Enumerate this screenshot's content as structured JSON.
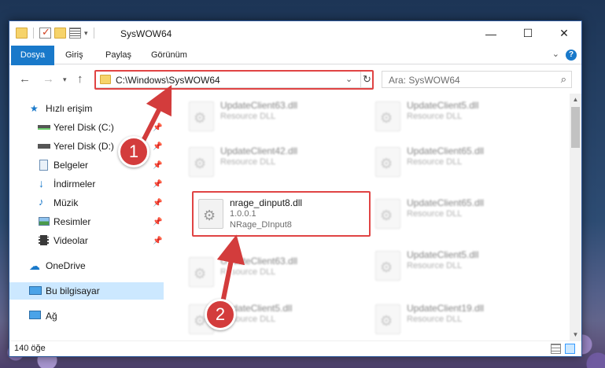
{
  "window": {
    "title": "SysWOW64"
  },
  "ribbon": {
    "tabs": [
      "Dosya",
      "Giriş",
      "Paylaş",
      "Görünüm"
    ]
  },
  "address": {
    "path": "C:\\Windows\\SysWOW64"
  },
  "search": {
    "placeholder": "Ara: SysWOW64"
  },
  "sidebar": {
    "items": [
      {
        "label": "Hızlı erişim",
        "icon": "star-icon"
      },
      {
        "label": "Yerel Disk (C:)",
        "icon": "drive-icon",
        "pinned": true
      },
      {
        "label": "Yerel Disk (D:)",
        "icon": "drive-icon",
        "pinned": true
      },
      {
        "label": "Belgeler",
        "icon": "documents-icon",
        "pinned": true
      },
      {
        "label": "İndirmeler",
        "icon": "download-icon",
        "pinned": true
      },
      {
        "label": "Müzik",
        "icon": "music-icon",
        "pinned": true
      },
      {
        "label": "Resimler",
        "icon": "pictures-icon",
        "pinned": true
      },
      {
        "label": "Videolar",
        "icon": "videos-icon",
        "pinned": true
      },
      {
        "label": "OneDrive",
        "icon": "cloud-icon"
      },
      {
        "label": "Bu bilgisayar",
        "icon": "computer-icon",
        "selected": true
      },
      {
        "label": "Ağ",
        "icon": "network-icon"
      }
    ]
  },
  "files": {
    "col1": [
      {
        "name": "UpdateClient63.dll",
        "sub": "Resource DLL"
      },
      {
        "name": "UpdateClient42.dll",
        "sub": "Resource DLL"
      },
      {
        "name": "nrage_dinput8.dll",
        "sub": "1.0.0.1",
        "sub2": "NRage_DInput8"
      },
      {
        "name": "UpdateClient63.dll",
        "sub": "Resource DLL"
      },
      {
        "name": "UpdateClient5.dll",
        "sub": "Resource DLL"
      }
    ],
    "col2": [
      {
        "name": "UpdateClient5.dll",
        "sub": "Resource DLL"
      },
      {
        "name": "UpdateClient65.dll",
        "sub": "Resource DLL"
      },
      {
        "name": "UpdateClient65.dll",
        "sub": "Resource DLL"
      },
      {
        "name": "UpdateClient5.dll",
        "sub": "Resource DLL"
      },
      {
        "name": "UpdateClient19.dll",
        "sub": "Resource DLL"
      }
    ]
  },
  "status": {
    "count": "140 öğe"
  },
  "annotations": {
    "badge1": "1",
    "badge2": "2",
    "color": "#d33c3c"
  }
}
